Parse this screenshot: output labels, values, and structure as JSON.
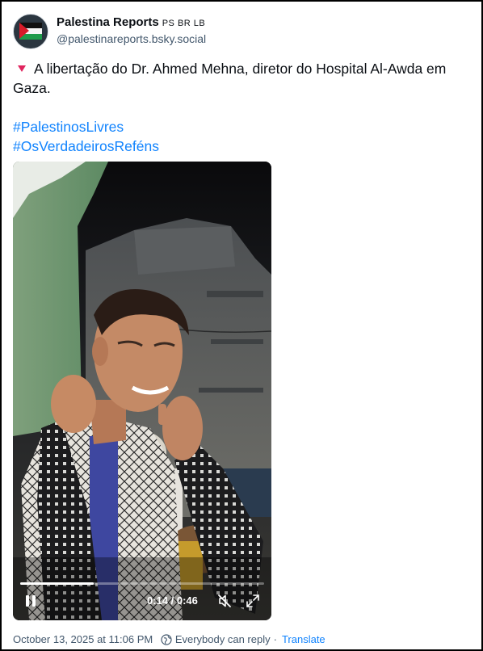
{
  "author": {
    "display_name": "Palestina Reports",
    "flags": "PS BR LB",
    "handle": "@palestinareports.bsky.social",
    "avatar_icon": "palestine-flag-icon"
  },
  "post": {
    "text": "A libertação do Dr. Ahmed Mehna, diretor do Hospital Al-Awda em Gaza.",
    "hashtags": [
      "#PalestinosLivres",
      "#OsVerdadeirosReféns"
    ]
  },
  "video": {
    "current_time": "0:14",
    "duration": "0:46",
    "time_display": "0:14 / 0:46",
    "progress_fraction": 0.3,
    "muted": true
  },
  "meta": {
    "timestamp": "October 13, 2025 at 11:06 PM",
    "reply_setting": "Everybody can reply",
    "separator": "·",
    "translate": "Translate"
  },
  "colors": {
    "link": "#1083fe",
    "muted_text": "#42576c",
    "triangle": "#e0245e"
  }
}
